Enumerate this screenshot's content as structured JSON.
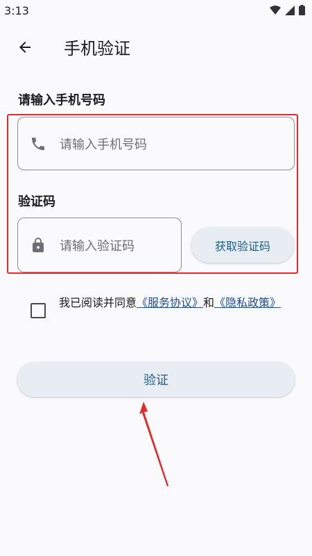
{
  "status_bar": {
    "time": "3:13"
  },
  "header": {
    "title": "手机验证"
  },
  "phone": {
    "label": "请输入手机号码",
    "placeholder": "请输入手机号码"
  },
  "code": {
    "label": "验证码",
    "placeholder": "请输入验证码",
    "button_label": "获取验证码"
  },
  "agreement": {
    "prefix": "我已阅读并同意",
    "service_link": "《服务协议》",
    "conjunction": "和",
    "privacy_link": "《隐私政策》",
    "checked": false
  },
  "verify_button": {
    "label": "验证"
  },
  "colors": {
    "accent": "#1d5f86",
    "annotation_red": "#e02b2b",
    "button_bg": "#e7edf2"
  }
}
